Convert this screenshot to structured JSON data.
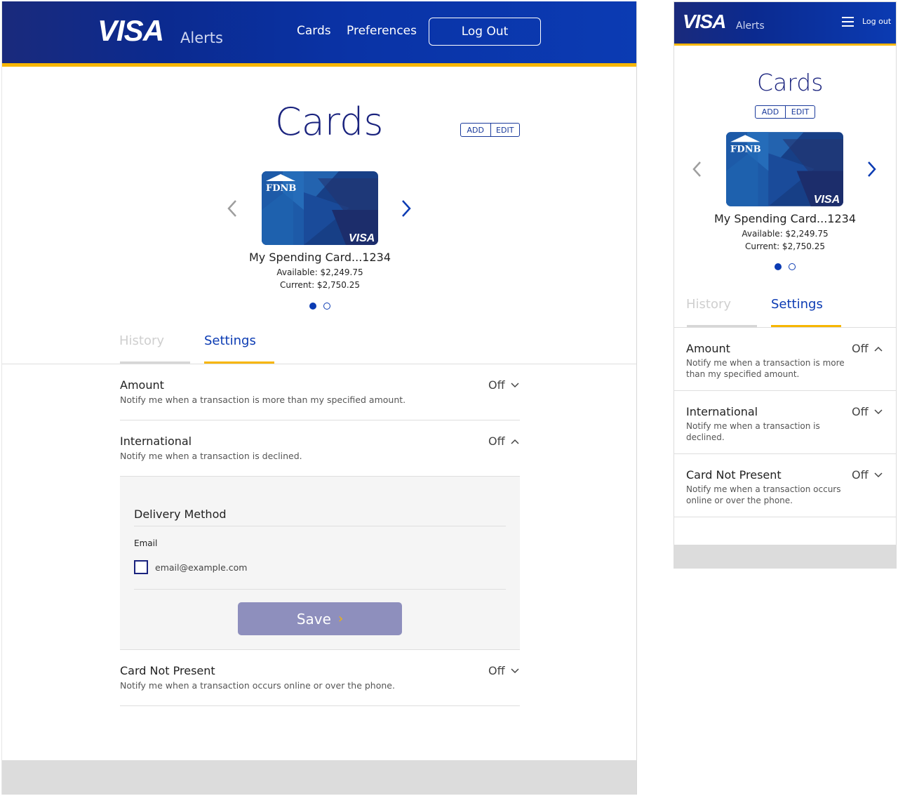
{
  "brand": {
    "logo": "VISA",
    "product": "Alerts"
  },
  "nav": {
    "cards": "Cards",
    "preferences": "Preferences",
    "logout": "Log Out",
    "logout_mobile": "Log out"
  },
  "page": {
    "title": "Cards",
    "add": "ADD",
    "edit": "EDIT"
  },
  "card": {
    "issuer": "FDNB",
    "network": "VISA",
    "name": "My Spending Card...1234",
    "available": "Available: $2,249.75",
    "current": "Current: $2,750.25",
    "page_count": 2,
    "active_page": 1
  },
  "tabs": {
    "history": "History",
    "settings": "Settings",
    "active": "Settings"
  },
  "settings": [
    {
      "title": "Amount",
      "desc": "Notify me when a transaction is more than my specified amount.",
      "state": "Off"
    },
    {
      "title": "International",
      "desc": "Notify me when a transaction is declined.",
      "state": "Off"
    },
    {
      "title": "Card Not Present",
      "desc": "Notify me when a transaction occurs online or over the phone.",
      "state": "Off"
    }
  ],
  "mobile_settings": [
    {
      "title": "Amount",
      "desc_line1": "Notify me when a transaction is more",
      "desc_line2": "than my specified amount.",
      "state": "Off"
    },
    {
      "title": "International",
      "desc_line1": "Notify me when a transaction is",
      "desc_line2": "declined.",
      "state": "Off"
    },
    {
      "title": "Card Not Present",
      "desc_line1": "Notify me when a transaction occurs",
      "desc_line2": "online or over the phone.",
      "state": "Off"
    }
  ],
  "delivery": {
    "heading": "Delivery Method",
    "label": "Email",
    "email": "email@example.com",
    "checked": false,
    "save": "Save",
    "save_chevron": "›"
  },
  "colors": {
    "header_blue": "#0b3bb3",
    "gold": "#f7b600",
    "title_navy": "#1a237e",
    "save_button": "#8e8fbd",
    "card_blue": "#1d5aa8"
  },
  "icons": [
    "chevron-left-icon",
    "chevron-right-icon",
    "chevron-down-icon",
    "chevron-up-icon",
    "hamburger-icon",
    "bank-icon"
  ]
}
